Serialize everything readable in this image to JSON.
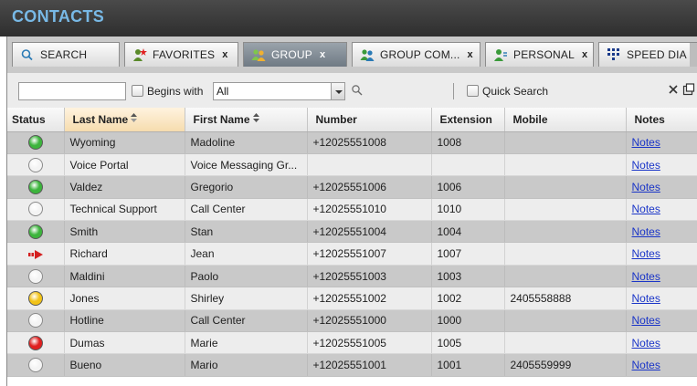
{
  "header": {
    "title": "CONTACTS"
  },
  "tabs": [
    {
      "label": "SEARCH",
      "icon": "search-icon",
      "closable": false,
      "active": false
    },
    {
      "label": "FAVORITES",
      "icon": "favorites-icon",
      "closable": true,
      "close_label": "x",
      "active": false
    },
    {
      "label": "GROUP",
      "icon": "group-icon",
      "closable": true,
      "close_label": "x",
      "active": true
    },
    {
      "label": "GROUP COM...",
      "icon": "group-common-icon",
      "closable": true,
      "close_label": "x",
      "active": false
    },
    {
      "label": "PERSONAL",
      "icon": "personal-icon",
      "closable": true,
      "close_label": "x",
      "active": false
    },
    {
      "label": "SPEED DIA",
      "icon": "speed-dial-icon",
      "closable": false,
      "active": false
    }
  ],
  "search": {
    "input_value": "",
    "begins_with_label": "Begins with",
    "begins_with_checked": false,
    "filter_selected": "All",
    "quick_search_label": "Quick Search",
    "quick_search_checked": false
  },
  "table": {
    "columns": [
      "Status",
      "Last Name",
      "First Name",
      "Number",
      "Extension",
      "Mobile",
      "Notes"
    ],
    "sorted_column": "Last Name",
    "notes_label": "Notes",
    "status_colors": {
      "available": "#3cb43c",
      "offline": "#f4f4f4",
      "busy": "#e02020",
      "away": "#f2c318",
      "forwarded": "#d42020"
    },
    "rows": [
      {
        "status": "available",
        "last": "Wyoming",
        "first": "Madoline",
        "number": "+12025551008",
        "ext": "1008",
        "mobile": ""
      },
      {
        "status": "offline",
        "last": "Voice Portal",
        "first": "Voice Messaging Gr...",
        "number": "",
        "ext": "",
        "mobile": ""
      },
      {
        "status": "available",
        "last": "Valdez",
        "first": "Gregorio",
        "number": "+12025551006",
        "ext": "1006",
        "mobile": ""
      },
      {
        "status": "offline",
        "last": "Technical Support",
        "first": "Call Center",
        "number": "+12025551010",
        "ext": "1010",
        "mobile": ""
      },
      {
        "status": "available",
        "last": "Smith",
        "first": "Stan",
        "number": "+12025551004",
        "ext": "1004",
        "mobile": ""
      },
      {
        "status": "forwarded",
        "last": "Richard",
        "first": "Jean",
        "number": "+12025551007",
        "ext": "1007",
        "mobile": ""
      },
      {
        "status": "offline",
        "last": "Maldini",
        "first": "Paolo",
        "number": "+12025551003",
        "ext": "1003",
        "mobile": ""
      },
      {
        "status": "away",
        "last": "Jones",
        "first": "Shirley",
        "number": "+12025551002",
        "ext": "1002",
        "mobile": "2405558888"
      },
      {
        "status": "offline",
        "last": "Hotline",
        "first": "Call Center",
        "number": "+12025551000",
        "ext": "1000",
        "mobile": ""
      },
      {
        "status": "busy",
        "last": "Dumas",
        "first": "Marie",
        "number": "+12025551005",
        "ext": "1005",
        "mobile": ""
      },
      {
        "status": "offline",
        "last": "Bueno",
        "first": "Mario",
        "number": "+12025551001",
        "ext": "1001",
        "mobile": "2405559999"
      }
    ]
  }
}
